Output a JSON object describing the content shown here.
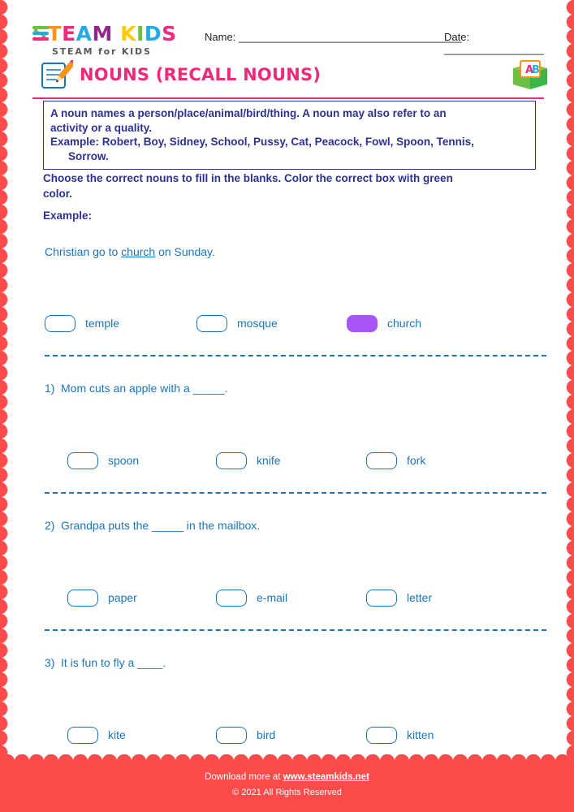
{
  "logo": {
    "word1": "STEAM",
    "word2": "KIDS",
    "tagline": "STEAM for KIDS",
    "colors": {
      "green": "#6cbe45",
      "orange": "#f7941e",
      "pink": "#ee2a7b",
      "blue": "#27aae1",
      "purple": "#92278f",
      "yellow": "#ffcb05"
    }
  },
  "header": {
    "name_label": "Name:",
    "name_rule": "______________________________________",
    "date_label": "Date:",
    "date_rule": "_________________"
  },
  "title": "NOUNS (RECALL NOUNS)",
  "definition": {
    "line1": "A noun names a person/place/animal/bird/thing. A noun may also refer to an",
    "line2": "activity or a quality.",
    "line3": "Example: Robert, Boy, Sidney, School, Pussy, Cat, Peacock, Fowl, Spoon, Tennis,",
    "line4": "Sorrow."
  },
  "instructions": {
    "line1": "Choose the correct nouns to fill in the blanks. Color the correct box with green",
    "line2": "color.",
    "example_label": "Example:"
  },
  "example": {
    "before": "Christian go to ",
    "answer": "church",
    "after": " on Sunday.",
    "options": [
      {
        "label": "temple",
        "filled": false
      },
      {
        "label": "mosque",
        "filled": false
      },
      {
        "label": "church",
        "filled": true
      }
    ],
    "fill_color": "#a855f7"
  },
  "questions": [
    {
      "number": "1)",
      "text": "Mom cuts an apple with a _____.",
      "options": [
        {
          "label": "spoon",
          "filled": false
        },
        {
          "label": "knife",
          "filled": false
        },
        {
          "label": "fork",
          "filled": false
        }
      ]
    },
    {
      "number": "2)",
      "text": "Grandpa puts the _____ in the mailbox.",
      "options": [
        {
          "label": "paper",
          "filled": false
        },
        {
          "label": "e-mail",
          "filled": false
        },
        {
          "label": "letter",
          "filled": false
        }
      ]
    },
    {
      "number": "3)",
      "text": "It is fun to fly a ____.",
      "options": [
        {
          "label": "kite",
          "filled": false
        },
        {
          "label": "bird",
          "filled": false
        },
        {
          "label": "kitten",
          "filled": false
        }
      ]
    }
  ],
  "book_icon": {
    "letter_a": "A",
    "letter_b": "B"
  },
  "footer": {
    "download_prefix": "Download more at ",
    "link": "www.steamkids.net",
    "copyright": "© 2021 All Rights Reserved"
  }
}
